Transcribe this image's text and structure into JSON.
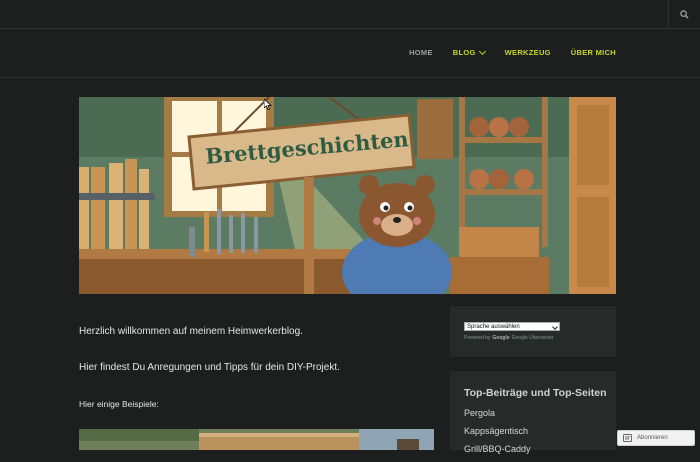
{
  "nav": {
    "items": [
      {
        "label": "HOME"
      },
      {
        "label": "BLOG"
      },
      {
        "label": "WERKZEUG"
      },
      {
        "label": "ÜBER MICH"
      }
    ]
  },
  "banner": {
    "sign_text": "Brettgeschichten"
  },
  "content": {
    "p1": "Herzlich willkommen auf meinem Heimwerkerblog.",
    "p2": "Hier findest Du Anregungen und Tipps für dein DIY-Projekt.",
    "p3": "Hier einige Beispiele:"
  },
  "translate": {
    "select_value": "Sprache auswählen",
    "powered_prefix": "Powered by",
    "google": "Google",
    "service": "Google Übersetzer"
  },
  "top_posts": {
    "title": "Top-Beiträge und Top-Seiten",
    "items": [
      "Pergola",
      "Kappsägentisch",
      "Grill/BBQ-Caddy"
    ]
  },
  "follow": {
    "label": "Abonnieren"
  },
  "colors": {
    "accent": "#c8d81e",
    "background": "#1c1f1e",
    "widget": "#262b29"
  }
}
